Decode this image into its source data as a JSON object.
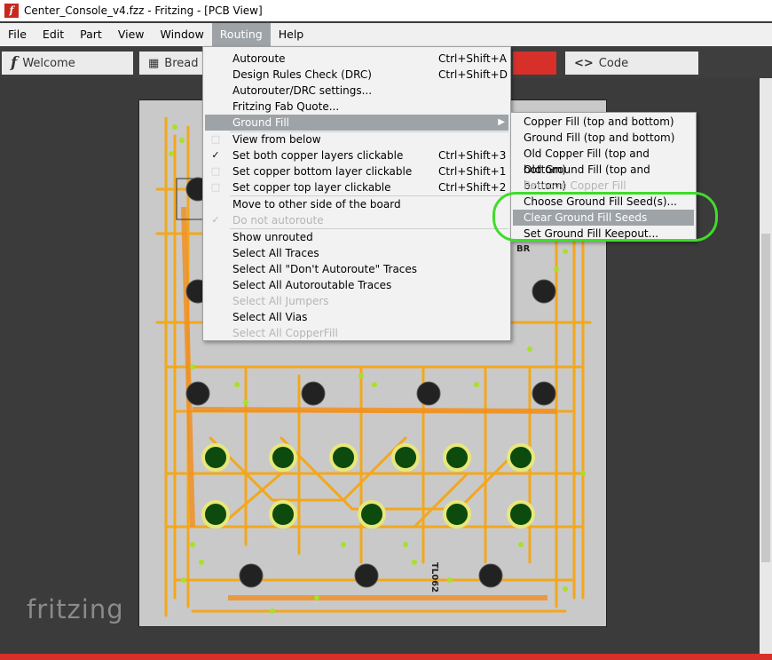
{
  "window": {
    "title": "Center_Console_v4.fzz - Fritzing - [PCB View]",
    "app_icon": "f"
  },
  "menubar": {
    "items": [
      {
        "label": "File"
      },
      {
        "label": "Edit"
      },
      {
        "label": "Part"
      },
      {
        "label": "View"
      },
      {
        "label": "Window"
      },
      {
        "label": "Routing",
        "active": true
      },
      {
        "label": "Help"
      }
    ]
  },
  "tabs": {
    "welcome": {
      "label": "Welcome",
      "icon": "f"
    },
    "breadboard": {
      "label": "Bread",
      "icon": "▦"
    },
    "code": {
      "label": "Code",
      "icon": "<>"
    }
  },
  "routing_menu": {
    "items": [
      {
        "label": "Autoroute",
        "shortcut": "Ctrl+Shift+A"
      },
      {
        "label": "Design Rules Check (DRC)",
        "shortcut": "Ctrl+Shift+D"
      },
      {
        "label": "Autorouter/DRC settings...",
        "shortcut": ""
      },
      {
        "label": "Fritzing Fab Quote...",
        "shortcut": ""
      },
      {
        "label": "Ground Fill",
        "shortcut": "",
        "submenu": true
      },
      {
        "label": "View from below",
        "shortcut": ""
      },
      {
        "label": "Set both copper layers clickable",
        "shortcut": "Ctrl+Shift+3",
        "checked": "✓"
      },
      {
        "label": "Set copper bottom layer clickable",
        "shortcut": "Ctrl+Shift+1"
      },
      {
        "label": "Set copper top layer clickable",
        "shortcut": "Ctrl+Shift+2"
      },
      {
        "label": "Move to other side of the board",
        "shortcut": ""
      },
      {
        "label": "Do not autoroute",
        "shortcut": "",
        "checked": "✓",
        "disabled": true
      },
      {
        "label": "Show unrouted",
        "shortcut": ""
      },
      {
        "label": "Select All Traces",
        "shortcut": ""
      },
      {
        "label": "Select All \"Don't Autoroute\" Traces",
        "shortcut": ""
      },
      {
        "label": "Select All Autoroutable Traces",
        "shortcut": ""
      },
      {
        "label": "Select All Jumpers",
        "shortcut": "",
        "disabled": true
      },
      {
        "label": "Select All Vias",
        "shortcut": ""
      },
      {
        "label": "Select All CopperFill",
        "shortcut": "",
        "disabled": true
      }
    ]
  },
  "ground_fill_submenu": {
    "items": [
      {
        "label": "Copper Fill (top and bottom)"
      },
      {
        "label": "Ground Fill (top and bottom)"
      },
      {
        "label": "Old Copper Fill (top and bottom)"
      },
      {
        "label": "Old Ground Fill (top and bottom)"
      },
      {
        "label": "Remove Copper Fill",
        "disabled": true
      },
      {
        "label": "Choose Ground Fill Seed(s)..."
      },
      {
        "label": "Clear Ground Fill Seeds",
        "highlighted": true
      },
      {
        "label": "Set Ground Fill Keepout..."
      }
    ]
  },
  "board": {
    "labels": [
      "BR",
      "TL062"
    ]
  },
  "logo": {
    "text": "fritzing"
  },
  "colors": {
    "trace": "#f2a81d",
    "pad": "#a8e02a",
    "annotation": "#3fdc2a",
    "accent": "#d7302a"
  }
}
